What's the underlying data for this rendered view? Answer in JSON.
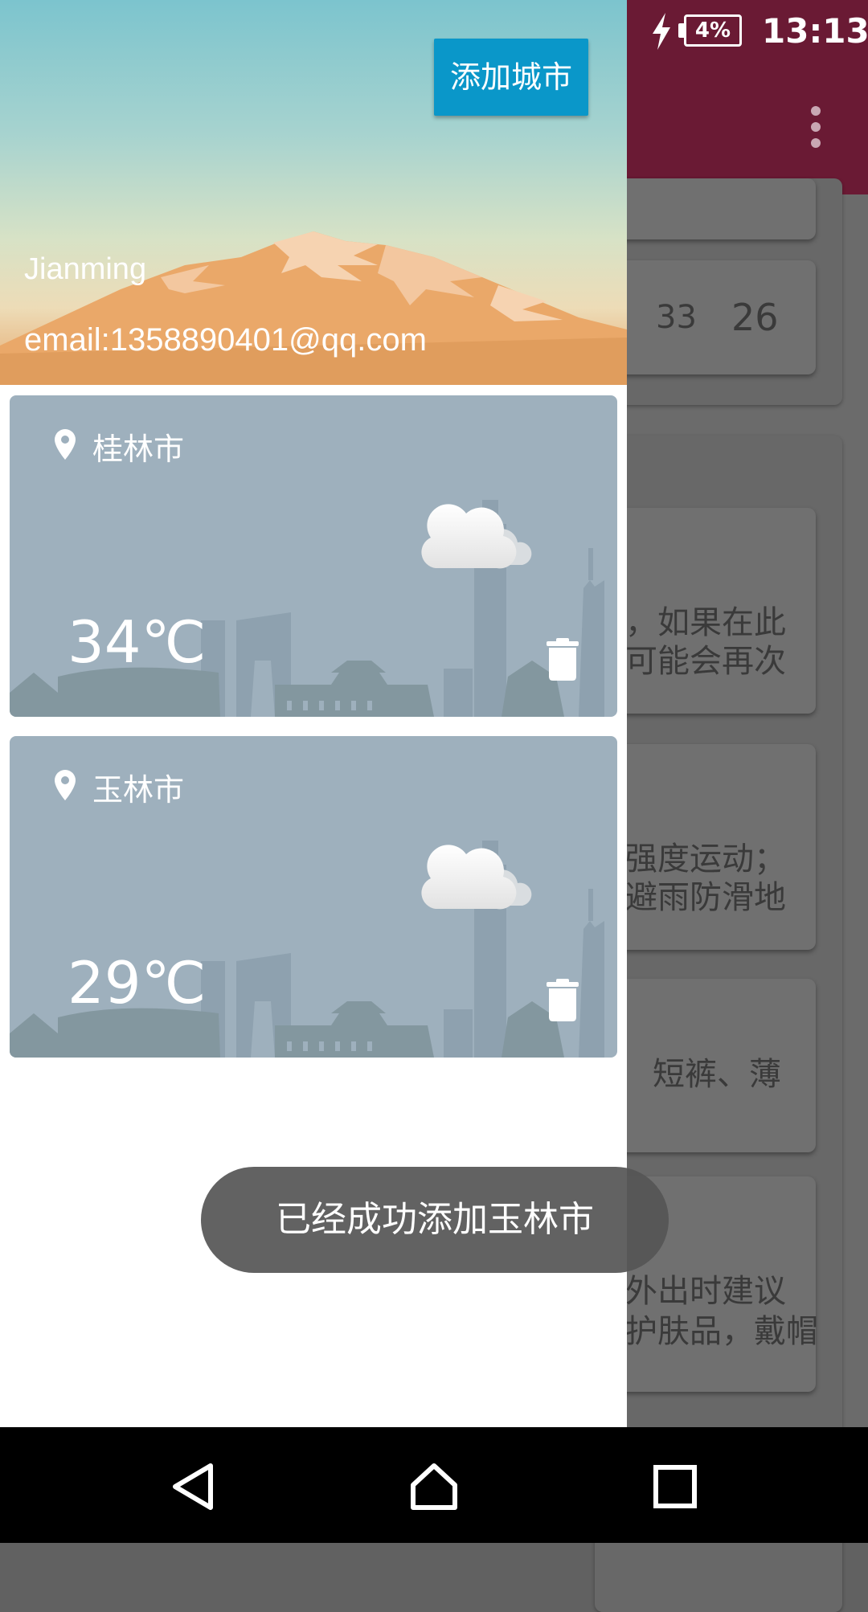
{
  "status_bar": {
    "time": "13:13",
    "battery": "4%",
    "icons": [
      "usb-icon",
      "screen-rotate-icon",
      "image-icon",
      "android-icon",
      "sim-alert-icon",
      "wifi-alert-icon",
      "no-signal-icon",
      "charging-icon"
    ]
  },
  "drawer": {
    "user_name": "Jianming",
    "email": "email:1358890401@qq.com",
    "add_city_label": "添加城市",
    "cities": [
      {
        "name": "桂林市",
        "temp": "34℃",
        "weather_icon": "cloudy-icon"
      },
      {
        "name": "玉林市",
        "temp": "29℃",
        "weather_icon": "cloudy-icon"
      }
    ]
  },
  "background": {
    "temps": [
      "33",
      "26"
    ],
    "snippets": [
      [
        "，如果在此",
        "可能会再次"
      ],
      [
        "强度运动；",
        "避雨防滑地"
      ],
      [
        "短裤、薄"
      ],
      [
        "外出时建议",
        "护肤品，戴帽"
      ]
    ]
  },
  "toast": "已经成功添加玉林市",
  "nav": [
    "back-icon",
    "home-icon",
    "recents-icon"
  ],
  "colors": {
    "toolbar": "#6a1a34",
    "add_city": "#0a97c9",
    "card": "#9eb0bd"
  }
}
